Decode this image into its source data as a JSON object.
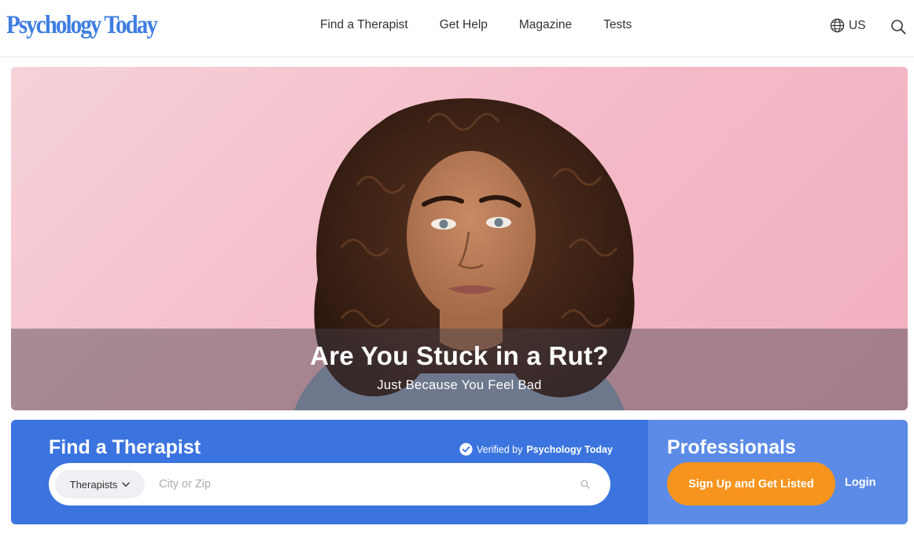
{
  "header": {
    "logo_text": "Psychology Today",
    "nav": [
      "Find a Therapist",
      "Get Help",
      "Magazine",
      "Tests"
    ],
    "region_label": "US",
    "icons": {
      "region": "globe-icon",
      "search": "search-icon"
    }
  },
  "hero": {
    "title": "Are You Stuck in a Rut?",
    "subtitle": "Just Because You Feel Bad"
  },
  "find_therapist": {
    "title": "Find a Therapist",
    "verified_prefix": "Verified by",
    "verified_brand": "Psychology Today",
    "select_value": "Therapists",
    "input_placeholder": "City or Zip",
    "input_value": ""
  },
  "professionals": {
    "title": "Professionals",
    "signup_label": "Sign Up and Get Listed",
    "login_label": "Login"
  },
  "colors": {
    "brand_blue": "#3b74df",
    "pro_blue": "#5b8be6",
    "cta_orange": "#f7941d",
    "hero_pink": "#f4b9c7"
  }
}
